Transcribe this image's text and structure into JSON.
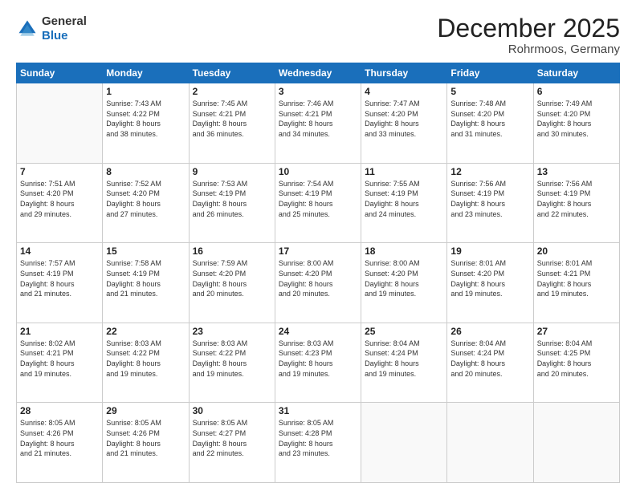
{
  "logo": {
    "general": "General",
    "blue": "Blue"
  },
  "header": {
    "month": "December 2025",
    "location": "Rohrmoos, Germany"
  },
  "days_of_week": [
    "Sunday",
    "Monday",
    "Tuesday",
    "Wednesday",
    "Thursday",
    "Friday",
    "Saturday"
  ],
  "weeks": [
    [
      {
        "day": "",
        "info": ""
      },
      {
        "day": "1",
        "info": "Sunrise: 7:43 AM\nSunset: 4:22 PM\nDaylight: 8 hours\nand 38 minutes."
      },
      {
        "day": "2",
        "info": "Sunrise: 7:45 AM\nSunset: 4:21 PM\nDaylight: 8 hours\nand 36 minutes."
      },
      {
        "day": "3",
        "info": "Sunrise: 7:46 AM\nSunset: 4:21 PM\nDaylight: 8 hours\nand 34 minutes."
      },
      {
        "day": "4",
        "info": "Sunrise: 7:47 AM\nSunset: 4:20 PM\nDaylight: 8 hours\nand 33 minutes."
      },
      {
        "day": "5",
        "info": "Sunrise: 7:48 AM\nSunset: 4:20 PM\nDaylight: 8 hours\nand 31 minutes."
      },
      {
        "day": "6",
        "info": "Sunrise: 7:49 AM\nSunset: 4:20 PM\nDaylight: 8 hours\nand 30 minutes."
      }
    ],
    [
      {
        "day": "7",
        "info": "Sunrise: 7:51 AM\nSunset: 4:20 PM\nDaylight: 8 hours\nand 29 minutes."
      },
      {
        "day": "8",
        "info": "Sunrise: 7:52 AM\nSunset: 4:20 PM\nDaylight: 8 hours\nand 27 minutes."
      },
      {
        "day": "9",
        "info": "Sunrise: 7:53 AM\nSunset: 4:19 PM\nDaylight: 8 hours\nand 26 minutes."
      },
      {
        "day": "10",
        "info": "Sunrise: 7:54 AM\nSunset: 4:19 PM\nDaylight: 8 hours\nand 25 minutes."
      },
      {
        "day": "11",
        "info": "Sunrise: 7:55 AM\nSunset: 4:19 PM\nDaylight: 8 hours\nand 24 minutes."
      },
      {
        "day": "12",
        "info": "Sunrise: 7:56 AM\nSunset: 4:19 PM\nDaylight: 8 hours\nand 23 minutes."
      },
      {
        "day": "13",
        "info": "Sunrise: 7:56 AM\nSunset: 4:19 PM\nDaylight: 8 hours\nand 22 minutes."
      }
    ],
    [
      {
        "day": "14",
        "info": "Sunrise: 7:57 AM\nSunset: 4:19 PM\nDaylight: 8 hours\nand 21 minutes."
      },
      {
        "day": "15",
        "info": "Sunrise: 7:58 AM\nSunset: 4:19 PM\nDaylight: 8 hours\nand 21 minutes."
      },
      {
        "day": "16",
        "info": "Sunrise: 7:59 AM\nSunset: 4:20 PM\nDaylight: 8 hours\nand 20 minutes."
      },
      {
        "day": "17",
        "info": "Sunrise: 8:00 AM\nSunset: 4:20 PM\nDaylight: 8 hours\nand 20 minutes."
      },
      {
        "day": "18",
        "info": "Sunrise: 8:00 AM\nSunset: 4:20 PM\nDaylight: 8 hours\nand 19 minutes."
      },
      {
        "day": "19",
        "info": "Sunrise: 8:01 AM\nSunset: 4:20 PM\nDaylight: 8 hours\nand 19 minutes."
      },
      {
        "day": "20",
        "info": "Sunrise: 8:01 AM\nSunset: 4:21 PM\nDaylight: 8 hours\nand 19 minutes."
      }
    ],
    [
      {
        "day": "21",
        "info": "Sunrise: 8:02 AM\nSunset: 4:21 PM\nDaylight: 8 hours\nand 19 minutes."
      },
      {
        "day": "22",
        "info": "Sunrise: 8:03 AM\nSunset: 4:22 PM\nDaylight: 8 hours\nand 19 minutes."
      },
      {
        "day": "23",
        "info": "Sunrise: 8:03 AM\nSunset: 4:22 PM\nDaylight: 8 hours\nand 19 minutes."
      },
      {
        "day": "24",
        "info": "Sunrise: 8:03 AM\nSunset: 4:23 PM\nDaylight: 8 hours\nand 19 minutes."
      },
      {
        "day": "25",
        "info": "Sunrise: 8:04 AM\nSunset: 4:24 PM\nDaylight: 8 hours\nand 19 minutes."
      },
      {
        "day": "26",
        "info": "Sunrise: 8:04 AM\nSunset: 4:24 PM\nDaylight: 8 hours\nand 20 minutes."
      },
      {
        "day": "27",
        "info": "Sunrise: 8:04 AM\nSunset: 4:25 PM\nDaylight: 8 hours\nand 20 minutes."
      }
    ],
    [
      {
        "day": "28",
        "info": "Sunrise: 8:05 AM\nSunset: 4:26 PM\nDaylight: 8 hours\nand 21 minutes."
      },
      {
        "day": "29",
        "info": "Sunrise: 8:05 AM\nSunset: 4:26 PM\nDaylight: 8 hours\nand 21 minutes."
      },
      {
        "day": "30",
        "info": "Sunrise: 8:05 AM\nSunset: 4:27 PM\nDaylight: 8 hours\nand 22 minutes."
      },
      {
        "day": "31",
        "info": "Sunrise: 8:05 AM\nSunset: 4:28 PM\nDaylight: 8 hours\nand 23 minutes."
      },
      {
        "day": "",
        "info": ""
      },
      {
        "day": "",
        "info": ""
      },
      {
        "day": "",
        "info": ""
      }
    ]
  ]
}
